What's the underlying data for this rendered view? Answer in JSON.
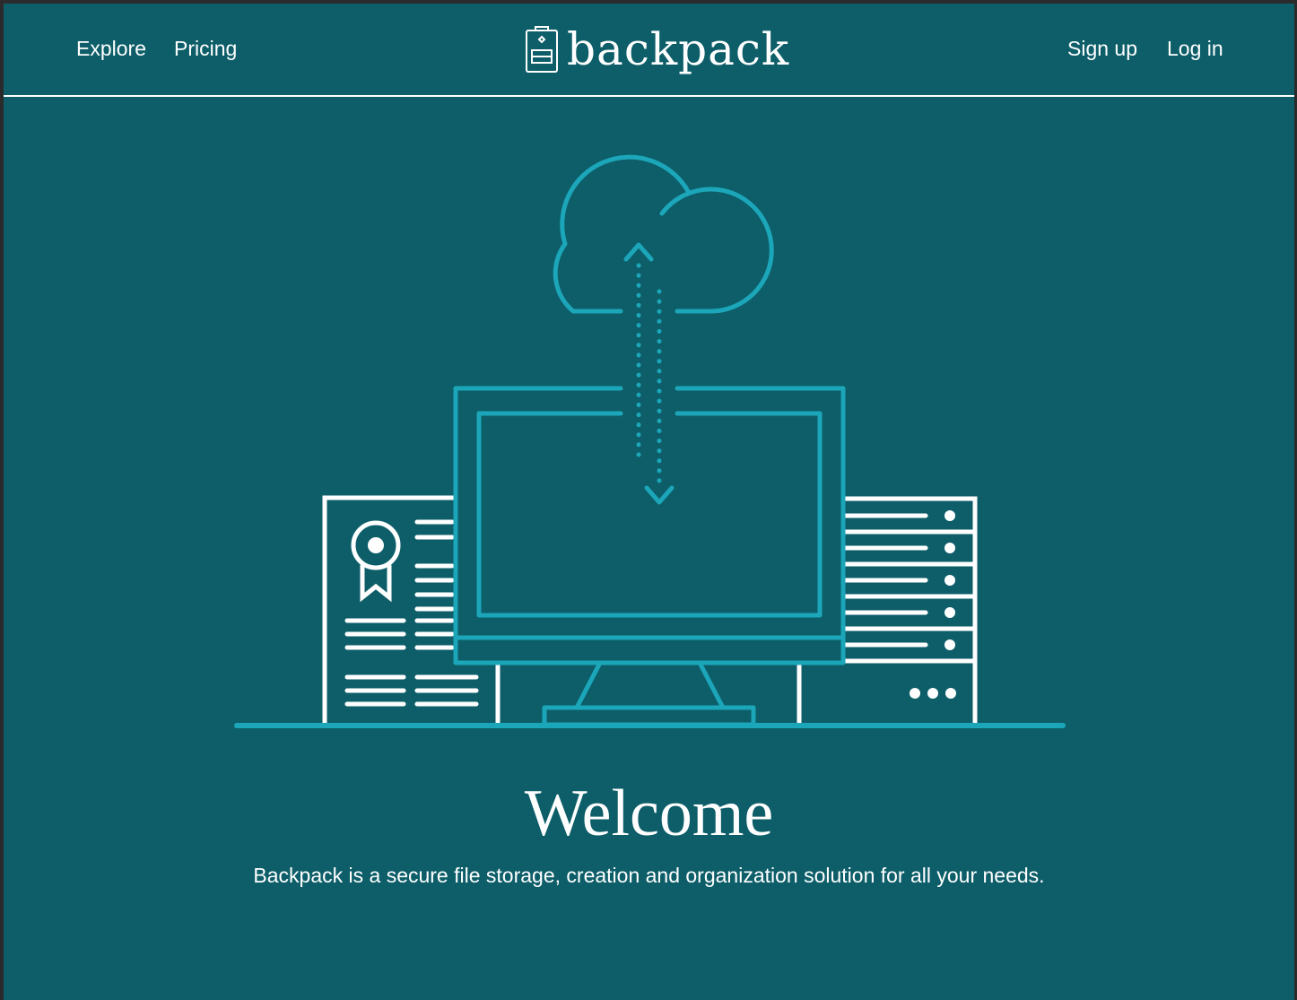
{
  "header": {
    "nav_left": [
      "Explore",
      "Pricing"
    ],
    "brand": "backpack",
    "nav_right": [
      "Sign up",
      "Log in"
    ]
  },
  "hero": {
    "illustration": [
      "cloud-icon",
      "sync-arrows-icon",
      "monitor-icon",
      "certificate-icon",
      "server-rack-icon"
    ],
    "title": "Welcome",
    "tagline": "Backpack is a secure file storage, creation and organization solution for all your needs."
  },
  "colors": {
    "background": "#0d5e69",
    "accent": "#1ca6b9",
    "text": "#ffffff"
  }
}
